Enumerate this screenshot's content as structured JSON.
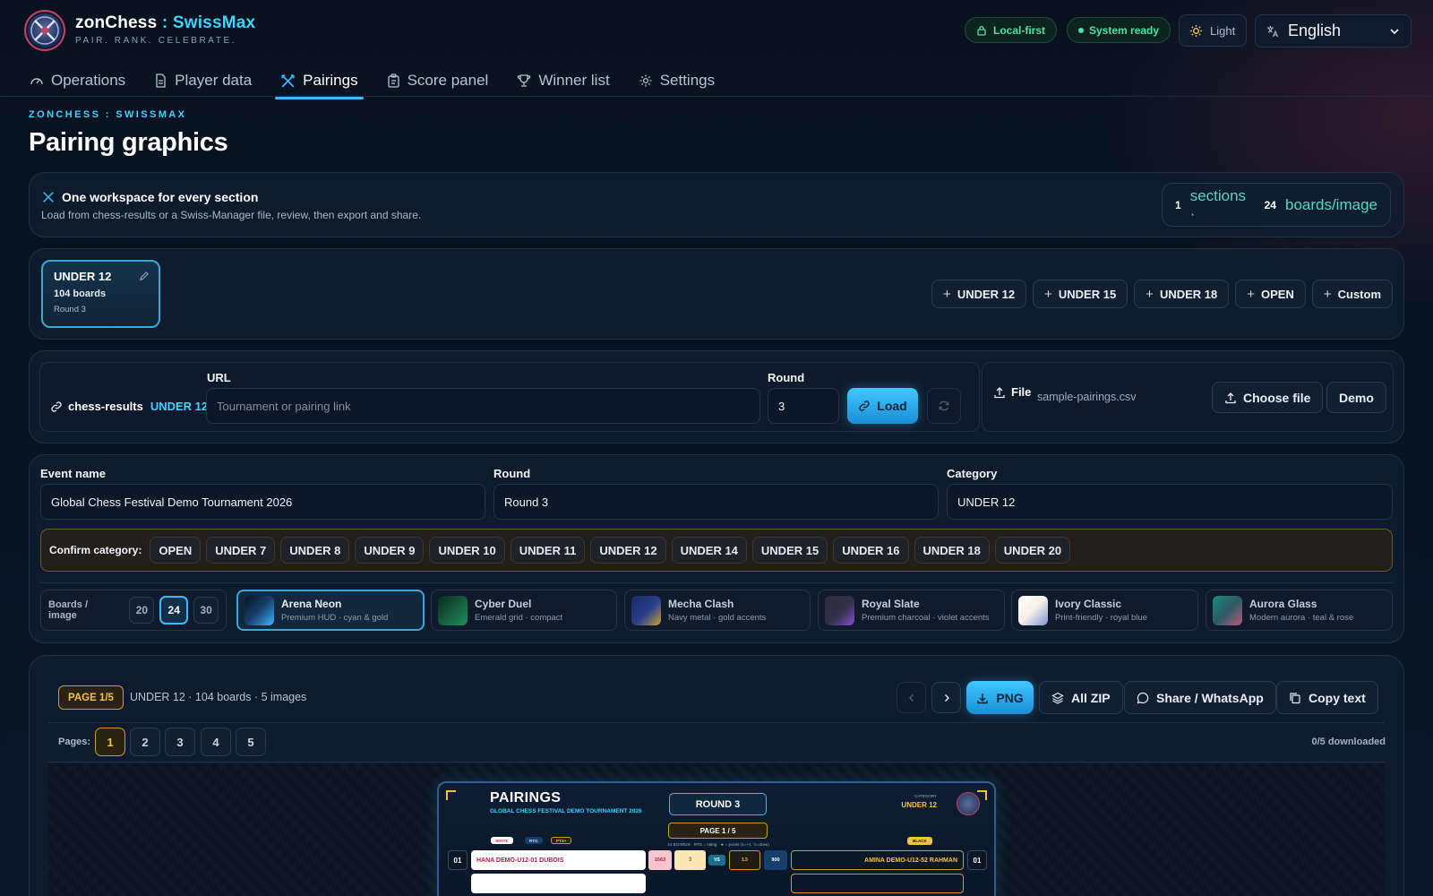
{
  "app": {
    "brand_name": "zonChess",
    "brand_sep": " : ",
    "brand_product": "SwissMax",
    "tagline": "PAIR. RANK. CELEBRATE."
  },
  "header": {
    "local_first": "Local-first",
    "system_ready": "System ready",
    "theme_toggle": "Light",
    "language": "English"
  },
  "tabs": [
    {
      "label": "Operations",
      "icon": "gauge-icon"
    },
    {
      "label": "Player data",
      "icon": "document-icon"
    },
    {
      "label": "Pairings",
      "icon": "crossed-swords-icon",
      "active": true
    },
    {
      "label": "Score panel",
      "icon": "clipboard-icon"
    },
    {
      "label": "Winner list",
      "icon": "trophy-icon"
    },
    {
      "label": "Settings",
      "icon": "gear-icon"
    }
  ],
  "page": {
    "eyebrow": "ZONCHESS : SWISSMAX",
    "title": "Pairing graphics"
  },
  "workspace": {
    "title": "One workspace for every section",
    "subtitle": "Load from chess-results or a Swiss-Manager file, review, then export and share.",
    "sections_count": "1",
    "sections_label": "sections ·",
    "boards_count": "24",
    "boards_label": "boards/image"
  },
  "section_card": {
    "name": "UNDER 12",
    "boards": "104 boards",
    "round": "Round 3"
  },
  "add_sections": [
    "UNDER 12",
    "UNDER 15",
    "UNDER 18",
    "OPEN",
    "Custom"
  ],
  "source": {
    "label": "chess-results",
    "section": "UNDER 12",
    "url_label": "URL",
    "url_placeholder": "Tournament or pairing link",
    "round_label": "Round",
    "round_value": "3",
    "load": "Load",
    "file_label": "File",
    "file_name": "sample-pairings.csv",
    "choose_file": "Choose file",
    "demo": "Demo"
  },
  "event": {
    "name_label": "Event name",
    "name_value": "Global Chess Festival Demo Tournament 2026",
    "round_label": "Round",
    "round_value": "Round 3",
    "category_label": "Category",
    "category_value": "UNDER 12"
  },
  "confirm": {
    "label": "Confirm category:",
    "options": [
      "OPEN",
      "UNDER 7",
      "UNDER 8",
      "UNDER 9",
      "UNDER 10",
      "UNDER 11",
      "UNDER 12",
      "UNDER 14",
      "UNDER 15",
      "UNDER 16",
      "UNDER 18",
      "UNDER 20"
    ]
  },
  "boards_per_image": {
    "label": "Boards / image",
    "options": [
      "20",
      "24",
      "30"
    ],
    "selected": "24"
  },
  "themes": [
    {
      "name": "Arena Neon",
      "desc": "Premium HUD · cyan & gold",
      "selected": true,
      "colors": [
        "#163f6a",
        "#0a1426"
      ]
    },
    {
      "name": "Cyber Duel",
      "desc": "Emerald grid · compact",
      "colors": [
        "#1f8f5e",
        "#0a2a1e"
      ]
    },
    {
      "name": "Mecha Clash",
      "desc": "Navy metal · gold accents",
      "colors": [
        "#2a3f8a",
        "#c9a23a"
      ]
    },
    {
      "name": "Royal Slate",
      "desc": "Premium charcoal · violet accents",
      "colors": [
        "#2b2b36",
        "#7c4fd0"
      ]
    },
    {
      "name": "Ivory Classic",
      "desc": "Print-friendly · royal blue",
      "colors": [
        "#f3f1ea",
        "#7d8fd0"
      ]
    },
    {
      "name": "Aurora Glass",
      "desc": "Modern aurora · teal & rose",
      "colors": [
        "#1f8a7a",
        "#b85a7e"
      ]
    }
  ],
  "export": {
    "page_badge": "PAGE 1/5",
    "summary": "UNDER 12 · 104 boards · 5 images",
    "png": "PNG",
    "zip": "All ZIP",
    "share": "Share / WhatsApp",
    "copy": "Copy text",
    "pages_label": "Pages:",
    "pages": [
      "1",
      "2",
      "3",
      "4",
      "5"
    ],
    "current_page": "1",
    "downloaded": "0/5 downloaded"
  },
  "preview": {
    "title": "PAIRINGS",
    "event": "GLOBAL CHESS FESTIVAL DEMO TOURNAMENT 2026",
    "round": "ROUND 3",
    "page": "PAGE 1 / 5",
    "note": "24 BOARDS · RTG = rating · ★ = points (1=+1, ½=draw)",
    "category_label": "CATEGORY",
    "category": "UNDER 12",
    "white_chip": "WHITE",
    "rtg_chip": "RTG",
    "pts_chip": "PTS+",
    "black_chip": "BLACK",
    "row": {
      "board": "01",
      "white": "HANA DEMO-U12-01 DUBOIS",
      "white_rtg": "1563",
      "white_pts": "3",
      "vs": "VS",
      "score": "1.5",
      "black_rtg": "900",
      "black": "AMINA DEMO-U12-52 RAHMAN",
      "board_r": "01"
    }
  },
  "colors": {
    "accent": "#3fd3ff",
    "gold": "#f5c048",
    "green": "#4ee0a6"
  }
}
